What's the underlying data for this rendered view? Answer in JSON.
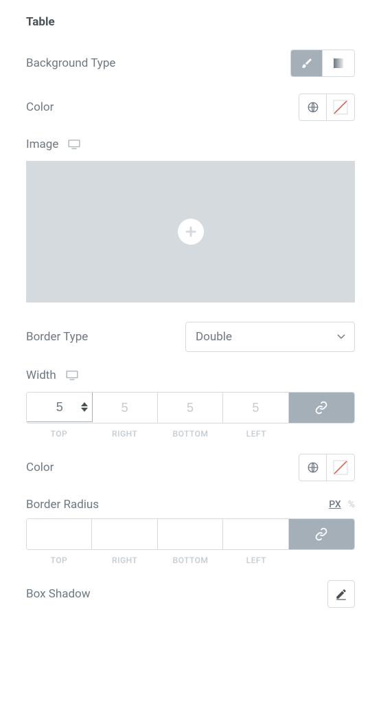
{
  "section": {
    "title": "Table"
  },
  "background": {
    "type_label": "Background Type",
    "color_label": "Color",
    "image_label": "Image"
  },
  "border": {
    "type_label": "Border Type",
    "type_value": "Double",
    "width_label": "Width",
    "width": {
      "top": "5",
      "right": "5",
      "bottom": "5",
      "left": "5"
    },
    "width_sublabels": {
      "top": "TOP",
      "right": "RIGHT",
      "bottom": "BOTTOM",
      "left": "LEFT"
    },
    "color_label": "Color",
    "radius_label": "Border Radius",
    "radius": {
      "top": "",
      "right": "",
      "bottom": "",
      "left": ""
    },
    "radius_sublabels": {
      "top": "TOP",
      "right": "RIGHT",
      "bottom": "BOTTOM",
      "left": "LEFT"
    },
    "units": {
      "px": "PX",
      "percent": "%"
    }
  },
  "box_shadow": {
    "label": "Box Shadow"
  }
}
